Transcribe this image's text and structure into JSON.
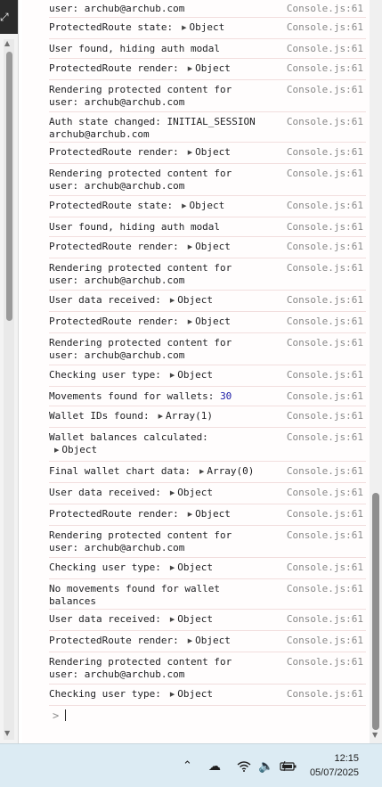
{
  "console": {
    "source": "Console.js:61",
    "prompt_symbol": ">",
    "rows": [
      {
        "text": "user: archub@archub.com",
        "h": 20
      },
      {
        "text": "ProtectedRoute state:",
        "obj": "Object",
        "h": 24
      },
      {
        "text": "User found, hiding auth modal",
        "h": 22
      },
      {
        "text": "ProtectedRoute render:",
        "obj": "Object",
        "h": 24
      },
      {
        "text": "Rendering protected content for user: archub@archub.com",
        "h": 36
      },
      {
        "text": "Auth state changed: INITIAL_SESSION archub@archub.com",
        "h": 34
      },
      {
        "text": "ProtectedRoute render:",
        "obj": "Object",
        "h": 24
      },
      {
        "text": "Rendering protected content for user: archub@archub.com",
        "h": 36
      },
      {
        "text": "ProtectedRoute state:",
        "obj": "Object",
        "h": 24
      },
      {
        "text": "User found, hiding auth modal",
        "h": 22
      },
      {
        "text": "ProtectedRoute render:",
        "obj": "Object",
        "h": 24
      },
      {
        "text": "Rendering protected content for user: archub@archub.com",
        "h": 36
      },
      {
        "text": "User data received:",
        "obj": "Object",
        "h": 24
      },
      {
        "text": "ProtectedRoute render:",
        "obj": "Object",
        "h": 24
      },
      {
        "text": "Rendering protected content for user: archub@archub.com",
        "h": 36
      },
      {
        "text": "Checking user type:",
        "obj": "Object",
        "h": 24
      },
      {
        "text": "Movements found for wallets:",
        "num": "30",
        "h": 22
      },
      {
        "text": "Wallet IDs found:",
        "obj": "Array(1)",
        "h": 24
      },
      {
        "text": "Wallet balances calculated:",
        "obj_line2": "Object",
        "h": 38
      },
      {
        "text": "Final wallet chart data:",
        "obj": "Array(0)",
        "h": 24
      },
      {
        "text": "User data received:",
        "obj": "Object",
        "h": 24
      },
      {
        "text": "ProtectedRoute render:",
        "obj": "Object",
        "h": 24
      },
      {
        "text": "Rendering protected content for user: archub@archub.com",
        "h": 36
      },
      {
        "text": "Checking user type:",
        "obj": "Object",
        "h": 24
      },
      {
        "text": "No movements found for wallet balances",
        "h": 34
      },
      {
        "text": "User data received:",
        "obj": "Object",
        "h": 24
      },
      {
        "text": "ProtectedRoute render:",
        "obj": "Object",
        "h": 24
      },
      {
        "text": "Rendering protected content for user: archub@archub.com",
        "h": 36
      },
      {
        "text": "Checking user type:",
        "obj": "Object",
        "h": 24
      }
    ]
  },
  "taskbar": {
    "time": "12:15",
    "date": "05/07/2025",
    "icons": [
      "chevron-up-icon",
      "cloud-icon",
      "wifi-icon",
      "speaker-icon",
      "battery-icon"
    ]
  }
}
